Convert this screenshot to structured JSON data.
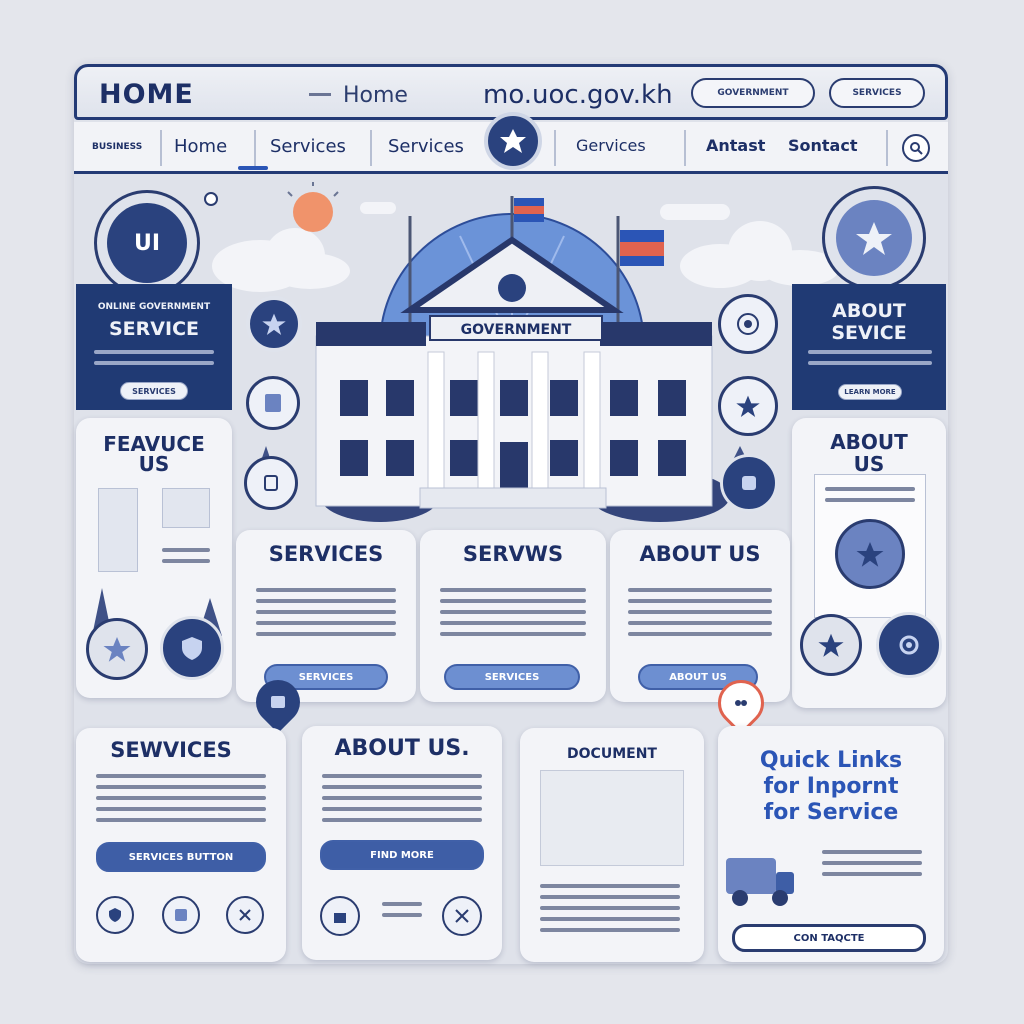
{
  "header": {
    "brand": "HOME",
    "breadcrumb": "Home",
    "domain": "mo.uoc.gov.kh",
    "pill_1": "GOVERNMENT",
    "pill_2": "SERVICES"
  },
  "nav": {
    "lead": "BUSINESS",
    "items": [
      "Home",
      "Services",
      "Services",
      "Gervices",
      "Antast",
      "Sontact"
    ]
  },
  "hero": {
    "building_sign": "GOVERNMENT",
    "badge_left": "UI"
  },
  "left_side": {
    "kicker": "ONLINE GOVERNMENT",
    "title": "SERVICE",
    "button": "SERVICES"
  },
  "right_side": {
    "title_line1": "ABOUT",
    "title_line2": "SEVICE",
    "button": "LEARN MORE"
  },
  "feature": {
    "title_line1": "FEAVUCE",
    "title_line2": "US"
  },
  "about_right": {
    "title_line1": "ABOUT",
    "title_line2": "US"
  },
  "mid_cards": [
    {
      "title": "SERVICES",
      "button": "SERVICES"
    },
    {
      "title": "SERVWS",
      "button": "SERVICES"
    },
    {
      "title": "ABOUT US",
      "button": "ABOUT US"
    }
  ],
  "bottom_cards": {
    "services": {
      "title": "SEWVICES",
      "button": "SERVICES BUTTON"
    },
    "about": {
      "title": "ABOUT US.",
      "button": "FIND MORE"
    },
    "document": {
      "header": "DOCUMENT"
    },
    "quick": {
      "line1": "Quick Links",
      "line2": "for Inpornt",
      "line3": "for Service",
      "button": "CON TAQCTE"
    }
  },
  "colors": {
    "navy": "#1d2f66",
    "accent": "#2b55b6",
    "button": "#6d8fd1",
    "panel": "#f3f4f8",
    "pin": "#e0634f"
  }
}
